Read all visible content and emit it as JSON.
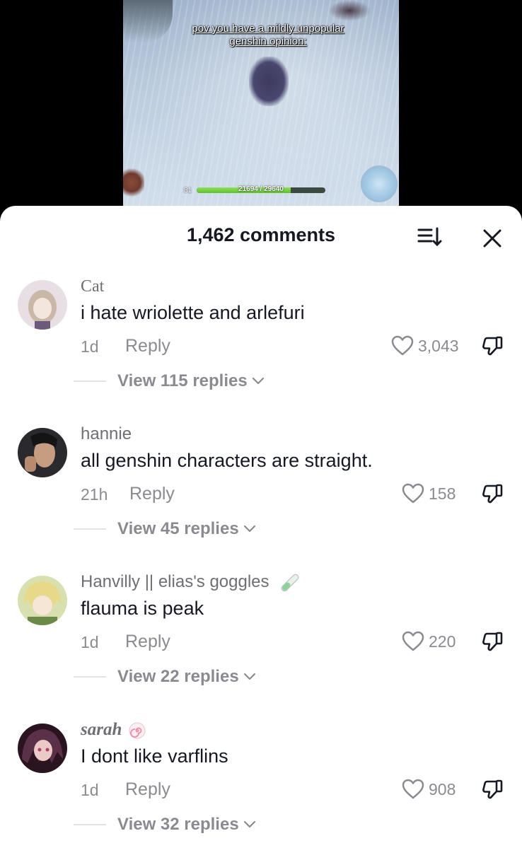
{
  "video": {
    "caption_line1": "pov you have a mildly unpopular",
    "caption_line2": "genshin opinion:",
    "hud": {
      "level": "81",
      "hp_text": "21694 / 29640",
      "hp_fraction": 0.732
    }
  },
  "header": {
    "comments_count": "1,462 comments",
    "sort_icon": "sort-icon",
    "close_icon": "close-icon"
  },
  "comments": [
    {
      "username": "Cat",
      "text": "i hate wriolette and arlefuri",
      "time": "1d",
      "reply_label": "Reply",
      "likes": "3,043",
      "view_replies": "View 115 replies",
      "avatar_colors": [
        "#e8dfe4",
        "#c9b8a8",
        "#6b5a7a"
      ]
    },
    {
      "username": "hannie",
      "text": "all genshin characters are straight.",
      "time": "21h",
      "reply_label": "Reply",
      "likes": "158",
      "view_replies": "View 45 replies",
      "avatar_colors": [
        "#2a2a2e",
        "#c79d82",
        "#141414"
      ]
    },
    {
      "username": "Hanvilly || elias's goggles",
      "text": "flauma is peak",
      "time": "1d",
      "reply_label": "Reply",
      "likes": "220",
      "view_replies": "View 22 replies",
      "avatar_colors": [
        "#c9d27a",
        "#e6d98a",
        "#6b8a4a"
      ]
    },
    {
      "username": "sarah",
      "text": "I dont like varflins",
      "time": "1d",
      "reply_label": "Reply",
      "likes": "908",
      "view_replies": "View 32 replies",
      "avatar_colors": [
        "#5a3148",
        "#b0406a",
        "#2a1420"
      ]
    }
  ],
  "colors": {
    "text_primary": "#161823",
    "text_secondary": "#8a8b91",
    "username": "#6e6f74"
  }
}
